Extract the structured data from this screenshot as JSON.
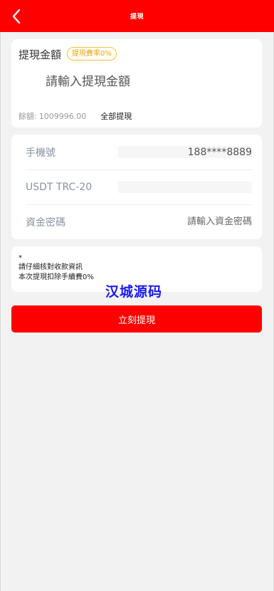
{
  "header": {
    "title": "提現",
    "back_icon": "chevron-left-icon",
    "background": "#ff0000"
  },
  "amount_card": {
    "title": "提現金額",
    "fee_badge": "提現費率0%",
    "amount_placeholder": "請輸入提現金額",
    "balance_label": "餘額:",
    "balance_value": "1009996.00",
    "withdraw_all_label": "全部提現"
  },
  "fields": [
    {
      "label": "手機號",
      "value": "188****8889"
    },
    {
      "label": "USDT TRC-20",
      "value": ""
    },
    {
      "label": "資金密碼",
      "placeholder": "請輸入資金密碼"
    }
  ],
  "notes": [
    "*",
    "請仔細核對收款資訊",
    "本次提現扣除手續費0%"
  ],
  "watermark": "汉城源码",
  "submit_label": "立刻提現"
}
